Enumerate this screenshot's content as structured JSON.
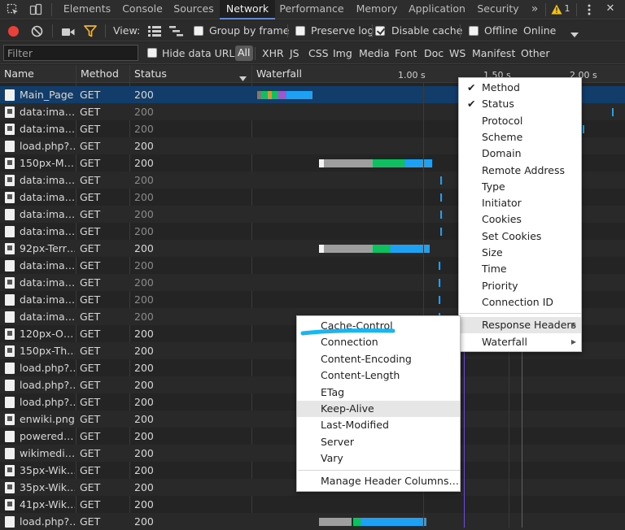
{
  "tabs": [
    {
      "label": "Elements",
      "active": false
    },
    {
      "label": "Console",
      "active": false
    },
    {
      "label": "Sources",
      "active": false
    },
    {
      "label": "Network",
      "active": true
    },
    {
      "label": "Performance",
      "active": false
    },
    {
      "label": "Memory",
      "active": false
    },
    {
      "label": "Application",
      "active": false
    },
    {
      "label": "Security",
      "active": false
    }
  ],
  "tabbar": {
    "overflow": "»",
    "warning_count": "1",
    "close": "✕"
  },
  "toolbar": {
    "view_label": "View:",
    "group_by_frame": {
      "label": "Group by frame",
      "checked": false
    },
    "preserve_log": {
      "label": "Preserve log",
      "checked": false
    },
    "disable_cache": {
      "label": "Disable cache",
      "checked": true
    },
    "offline": {
      "label": "Offline",
      "checked": false
    },
    "throttle": "Online"
  },
  "filter": {
    "placeholder": "Filter",
    "hide_data_urls": {
      "label": "Hide data URLs",
      "checked": false
    },
    "types": [
      "All",
      "XHR",
      "JS",
      "CSS",
      "Img",
      "Media",
      "Font",
      "Doc",
      "WS",
      "Manifest",
      "Other"
    ]
  },
  "columns": {
    "name": "Name",
    "method": "Method",
    "status": "Status",
    "waterfall": "Waterfall"
  },
  "waterfall_ticks": [
    "1.00 s",
    "1.50 s",
    "2.00 s"
  ],
  "rows": [
    {
      "name": "Main_Page",
      "method": "GET",
      "status": "200",
      "dim": false,
      "icon": "doc",
      "selected": true
    },
    {
      "name": "data:ima…",
      "method": "GET",
      "status": "200",
      "dim": true,
      "icon": "img"
    },
    {
      "name": "data:ima…",
      "method": "GET",
      "status": "200",
      "dim": true,
      "icon": "img"
    },
    {
      "name": "load.php?…",
      "method": "GET",
      "status": "200",
      "dim": false,
      "icon": "doc"
    },
    {
      "name": "150px-M…",
      "method": "GET",
      "status": "200",
      "dim": false,
      "icon": "img"
    },
    {
      "name": "data:ima…",
      "method": "GET",
      "status": "200",
      "dim": true,
      "icon": "img"
    },
    {
      "name": "data:ima…",
      "method": "GET",
      "status": "200",
      "dim": true,
      "icon": "img"
    },
    {
      "name": "data:ima…",
      "method": "GET",
      "status": "200",
      "dim": true,
      "icon": "doc"
    },
    {
      "name": "data:ima…",
      "method": "GET",
      "status": "200",
      "dim": true,
      "icon": "doc"
    },
    {
      "name": "92px-Terr…",
      "method": "GET",
      "status": "200",
      "dim": false,
      "icon": "img"
    },
    {
      "name": "data:ima…",
      "method": "GET",
      "status": "200",
      "dim": true,
      "icon": "doc"
    },
    {
      "name": "data:ima…",
      "method": "GET",
      "status": "200",
      "dim": true,
      "icon": "img"
    },
    {
      "name": "data:ima…",
      "method": "GET",
      "status": "200",
      "dim": true,
      "icon": "doc"
    },
    {
      "name": "data:ima…",
      "method": "GET",
      "status": "200",
      "dim": true,
      "icon": "doc"
    },
    {
      "name": "120px-O…",
      "method": "GET",
      "status": "200",
      "dim": false,
      "icon": "img"
    },
    {
      "name": "150px-Th…",
      "method": "GET",
      "status": "200",
      "dim": false,
      "icon": "img"
    },
    {
      "name": "load.php?…",
      "method": "GET",
      "status": "200",
      "dim": false,
      "icon": "doc"
    },
    {
      "name": "load.php?…",
      "method": "GET",
      "status": "200",
      "dim": false,
      "icon": "doc"
    },
    {
      "name": "load.php?…",
      "method": "GET",
      "status": "200",
      "dim": false,
      "icon": "doc"
    },
    {
      "name": "enwiki.png",
      "method": "GET",
      "status": "200",
      "dim": false,
      "icon": "img"
    },
    {
      "name": "powered…",
      "method": "GET",
      "status": "200",
      "dim": false,
      "icon": "doc"
    },
    {
      "name": "wikimedi…",
      "method": "GET",
      "status": "200",
      "dim": false,
      "icon": "doc"
    },
    {
      "name": "35px-Wik…",
      "method": "GET",
      "status": "200",
      "dim": false,
      "icon": "img"
    },
    {
      "name": "35px-Wik…",
      "method": "GET",
      "status": "200",
      "dim": false,
      "icon": "img"
    },
    {
      "name": "41px-Wik…",
      "method": "GET",
      "status": "200",
      "dim": false,
      "icon": "img"
    },
    {
      "name": "load.php?…",
      "method": "GET",
      "status": "200",
      "dim": false,
      "icon": "doc"
    }
  ],
  "column_menu": {
    "items": [
      {
        "label": "Method",
        "checked": true
      },
      {
        "label": "Status",
        "checked": true
      },
      {
        "label": "Protocol",
        "checked": false
      },
      {
        "label": "Scheme",
        "checked": false
      },
      {
        "label": "Domain",
        "checked": false
      },
      {
        "label": "Remote Address",
        "checked": false
      },
      {
        "label": "Type",
        "checked": false
      },
      {
        "label": "Initiator",
        "checked": false
      },
      {
        "label": "Cookies",
        "checked": false
      },
      {
        "label": "Set Cookies",
        "checked": false
      },
      {
        "label": "Size",
        "checked": false
      },
      {
        "label": "Time",
        "checked": false
      },
      {
        "label": "Priority",
        "checked": false
      },
      {
        "label": "Connection ID",
        "checked": false
      }
    ],
    "submenus": [
      {
        "label": "Response Headers",
        "active": true
      },
      {
        "label": "Waterfall",
        "active": false
      }
    ]
  },
  "headers_menu": {
    "items": [
      "Cache-Control",
      "Connection",
      "Content-Encoding",
      "Content-Length",
      "ETag",
      "Keep-Alive",
      "Last-Modified",
      "Server",
      "Vary"
    ],
    "hovered": "Keep-Alive",
    "manage": "Manage Header Columns…"
  },
  "colors": {
    "accent": "#5a8be0",
    "record": "#e8403a",
    "filter_icon": "#f0b432",
    "highlight_stroke": "#19b5f0",
    "waiting": "#9e9e9e",
    "ttfb": "#10c060",
    "download": "#1ea1f2"
  }
}
